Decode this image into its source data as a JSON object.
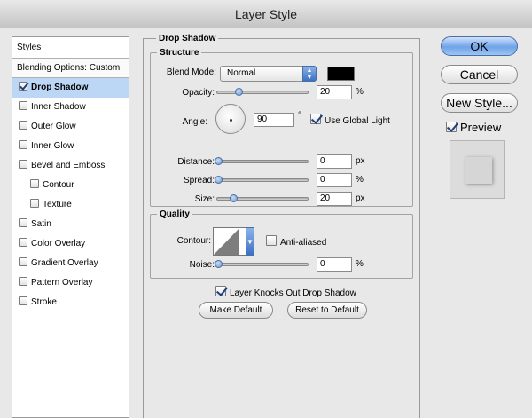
{
  "window": {
    "title": "Layer Style"
  },
  "styles_panel": {
    "header": "Styles",
    "blending_options": "Blending Options: Custom",
    "items": [
      {
        "label": "Drop Shadow",
        "checked": true,
        "selected": true,
        "indent": false
      },
      {
        "label": "Inner Shadow",
        "checked": false,
        "selected": false,
        "indent": false
      },
      {
        "label": "Outer Glow",
        "checked": false,
        "selected": false,
        "indent": false
      },
      {
        "label": "Inner Glow",
        "checked": false,
        "selected": false,
        "indent": false
      },
      {
        "label": "Bevel and Emboss",
        "checked": false,
        "selected": false,
        "indent": false
      },
      {
        "label": "Contour",
        "checked": false,
        "selected": false,
        "indent": true
      },
      {
        "label": "Texture",
        "checked": false,
        "selected": false,
        "indent": true
      },
      {
        "label": "Satin",
        "checked": false,
        "selected": false,
        "indent": false
      },
      {
        "label": "Color Overlay",
        "checked": false,
        "selected": false,
        "indent": false
      },
      {
        "label": "Gradient Overlay",
        "checked": false,
        "selected": false,
        "indent": false
      },
      {
        "label": "Pattern Overlay",
        "checked": false,
        "selected": false,
        "indent": false
      },
      {
        "label": "Stroke",
        "checked": false,
        "selected": false,
        "indent": false
      }
    ]
  },
  "drop_shadow": {
    "section_title": "Drop Shadow",
    "structure": {
      "title": "Structure",
      "blend_mode_label": "Blend Mode:",
      "blend_mode_value": "Normal",
      "shadow_color": "#000000",
      "opacity_label": "Opacity:",
      "opacity_value": "20",
      "opacity_unit": "%",
      "angle_label": "Angle:",
      "angle_value": "90",
      "angle_unit": "°",
      "use_global_light_label": "Use Global Light",
      "use_global_light": true,
      "distance_label": "Distance:",
      "distance_value": "0",
      "distance_unit": "px",
      "spread_label": "Spread:",
      "spread_value": "0",
      "spread_unit": "%",
      "size_label": "Size:",
      "size_value": "20",
      "size_unit": "px"
    },
    "quality": {
      "title": "Quality",
      "contour_label": "Contour:",
      "anti_aliased_label": "Anti-aliased",
      "anti_aliased": false,
      "noise_label": "Noise:",
      "noise_value": "0",
      "noise_unit": "%"
    },
    "layer_knocks_out_label": "Layer Knocks Out Drop Shadow",
    "layer_knocks_out": true,
    "make_default_label": "Make Default",
    "reset_default_label": "Reset to Default"
  },
  "buttons": {
    "ok": "OK",
    "cancel": "Cancel",
    "new_style": "New Style...",
    "preview_label": "Preview",
    "preview_checked": true
  }
}
